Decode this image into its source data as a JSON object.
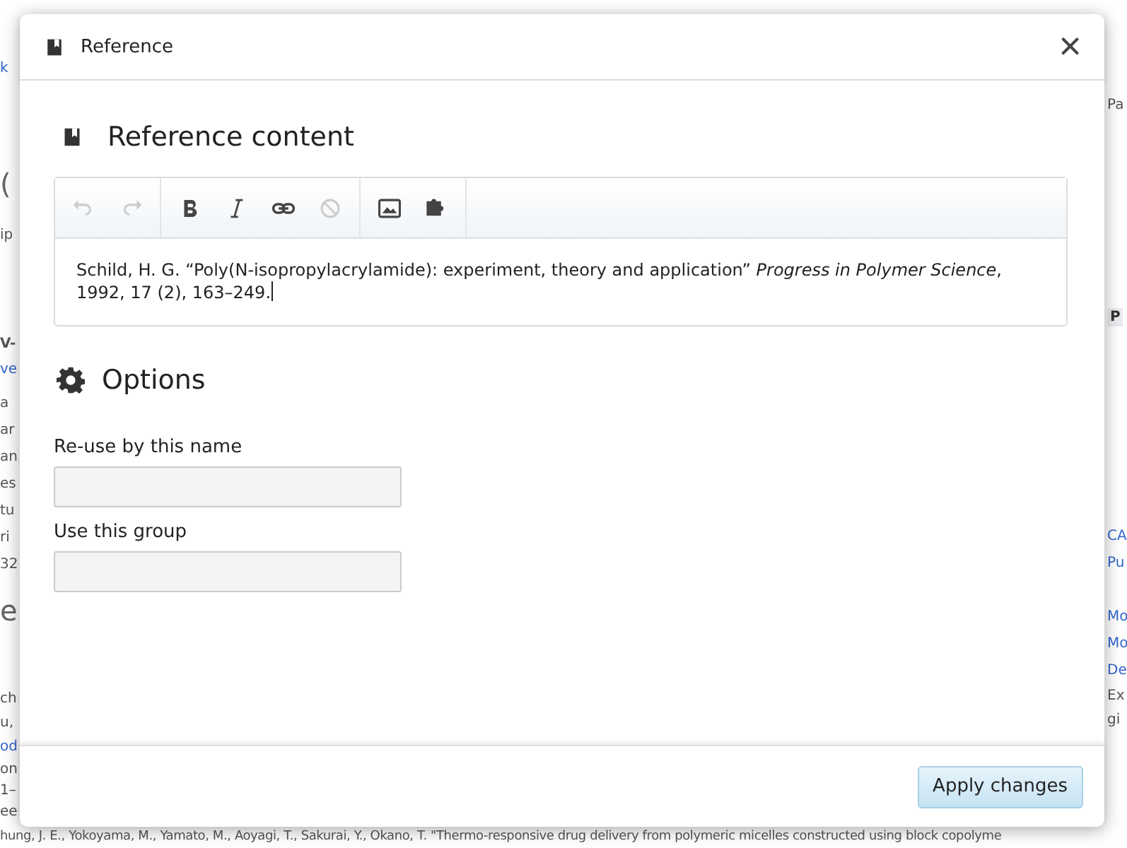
{
  "background": {
    "left_fragments": [
      {
        "text": "k",
        "kind": "link"
      },
      {
        "text": "(",
        "kind": "big"
      },
      {
        "text": "ip",
        "kind": "plain"
      },
      {
        "text": "V-",
        "kind": "bold"
      },
      {
        "text": "ve",
        "kind": "link"
      },
      {
        "text": "a",
        "kind": "plain"
      },
      {
        "text": "ar",
        "kind": "plain"
      },
      {
        "text": "an",
        "kind": "plain"
      },
      {
        "text": "es",
        "kind": "plain"
      },
      {
        "text": "tu",
        "kind": "plain"
      },
      {
        "text": "ri",
        "kind": "plain"
      },
      {
        "text": "32",
        "kind": "plain"
      },
      {
        "text": "e",
        "kind": "big"
      },
      {
        "text": "ch",
        "kind": "plain"
      },
      {
        "text": "u,",
        "kind": "plain"
      },
      {
        "text": "od",
        "kind": "link"
      },
      {
        "text": "on",
        "kind": "plain"
      },
      {
        "text": "1–",
        "kind": "plain"
      },
      {
        "text": "ee",
        "kind": "plain"
      }
    ],
    "right_fragments": [
      {
        "text": "Pa",
        "kind": "plain"
      },
      {
        "text": "P",
        "kind": "boldbox"
      },
      {
        "text": "CA",
        "kind": "link"
      },
      {
        "text": "Pu",
        "kind": "link"
      },
      {
        "text": "Mo",
        "kind": "link"
      },
      {
        "text": "Mo",
        "kind": "link"
      },
      {
        "text": "De",
        "kind": "link"
      },
      {
        "text": "Ex",
        "kind": "plain"
      },
      {
        "text": "gi",
        "kind": "plain"
      }
    ],
    "bottom_line": "hung, J. E., Yokoyama, M., Yamato, M., Aoyagi, T., Sakurai, Y., Okano, T. \"Thermo-responsive drug delivery from polymeric micelles constructed using block copolyme"
  },
  "dialog": {
    "title": "Reference",
    "close": "×",
    "content_heading": "Reference content",
    "toolbar": [
      {
        "kind": "undo",
        "disabled": true
      },
      {
        "kind": "redo",
        "disabled": true
      },
      {
        "kind": "bold",
        "disabled": false
      },
      {
        "kind": "italic",
        "disabled": false
      },
      {
        "kind": "link",
        "disabled": false
      },
      {
        "kind": "clear",
        "disabled": true
      },
      {
        "kind": "image",
        "disabled": false
      },
      {
        "kind": "template",
        "disabled": false
      }
    ],
    "reference_text": "Schild, H. G. “Poly(N-isopropylacrylamide): experiment, theory and application” *Progress in Polymer Science*, 1992, 17 (2), 163–249.",
    "options_heading": "Options",
    "fields": [
      {
        "label": "Re-use by this name"
      },
      {
        "label": "Use this group"
      }
    ],
    "apply_button": "Apply changes"
  }
}
